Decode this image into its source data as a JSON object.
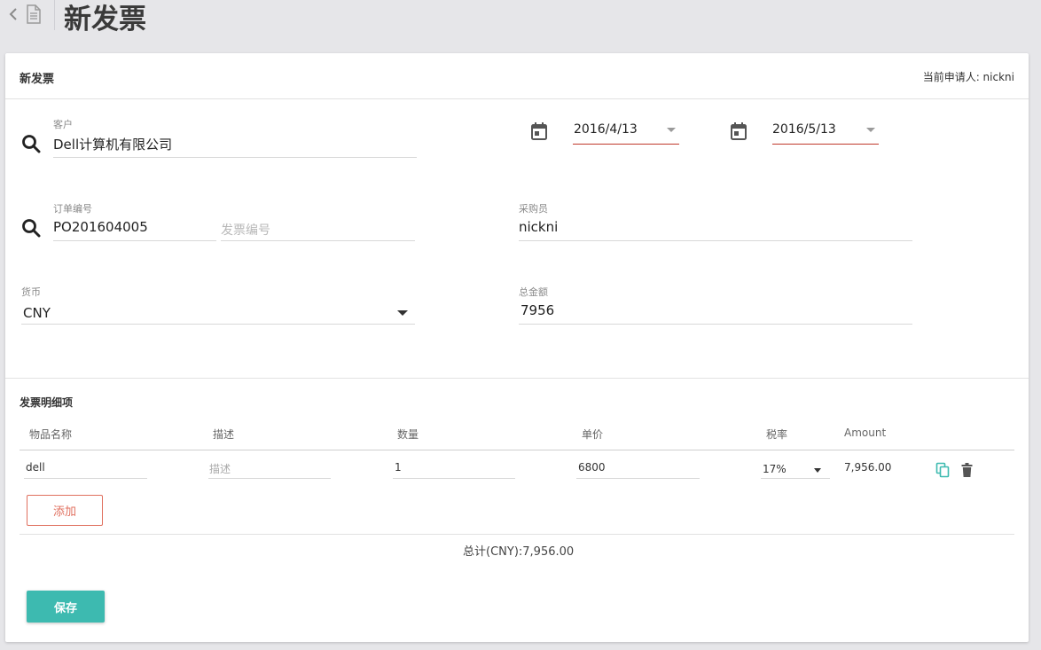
{
  "header": {
    "title": "新发票"
  },
  "card": {
    "title": "新发票",
    "applicant": "当前申请人: nickni"
  },
  "form": {
    "customer": {
      "label": "客户",
      "value": "Dell计算机有限公司"
    },
    "date_start": {
      "value": "2016/4/13"
    },
    "date_end": {
      "value": "2016/5/13"
    },
    "order_no": {
      "label": "订单编号",
      "value": "PO201604005"
    },
    "invoice_no": {
      "placeholder": "发票编号"
    },
    "buyer": {
      "label": "采购员",
      "value": "nickni"
    },
    "currency": {
      "label": "货币",
      "value": "CNY"
    },
    "total_amount": {
      "label": "总金额",
      "value": "7956"
    }
  },
  "items": {
    "section_title": "发票明细项",
    "columns": [
      "物品名称",
      "描述",
      "数量",
      "单价",
      "税率",
      "Amount"
    ],
    "rows": [
      {
        "name": "dell",
        "desc_placeholder": "描述",
        "qty": "1",
        "price": "6800",
        "tax": "17%",
        "amount": "7,956.00"
      }
    ],
    "add_label": "添加",
    "total_text": "总计(CNY):7,956.00"
  },
  "actions": {
    "save_label": "保存"
  },
  "icons": {
    "back": "chevron-left-icon",
    "doc": "document-icon",
    "search": "search-icon",
    "calendar": "calendar-icon",
    "copy": "copy-icon",
    "delete": "trash-icon"
  },
  "colors": {
    "accent": "#3dbab0",
    "danger": "#e0705f",
    "date_underline": "#c0392b",
    "background": "#e6e6e9"
  }
}
